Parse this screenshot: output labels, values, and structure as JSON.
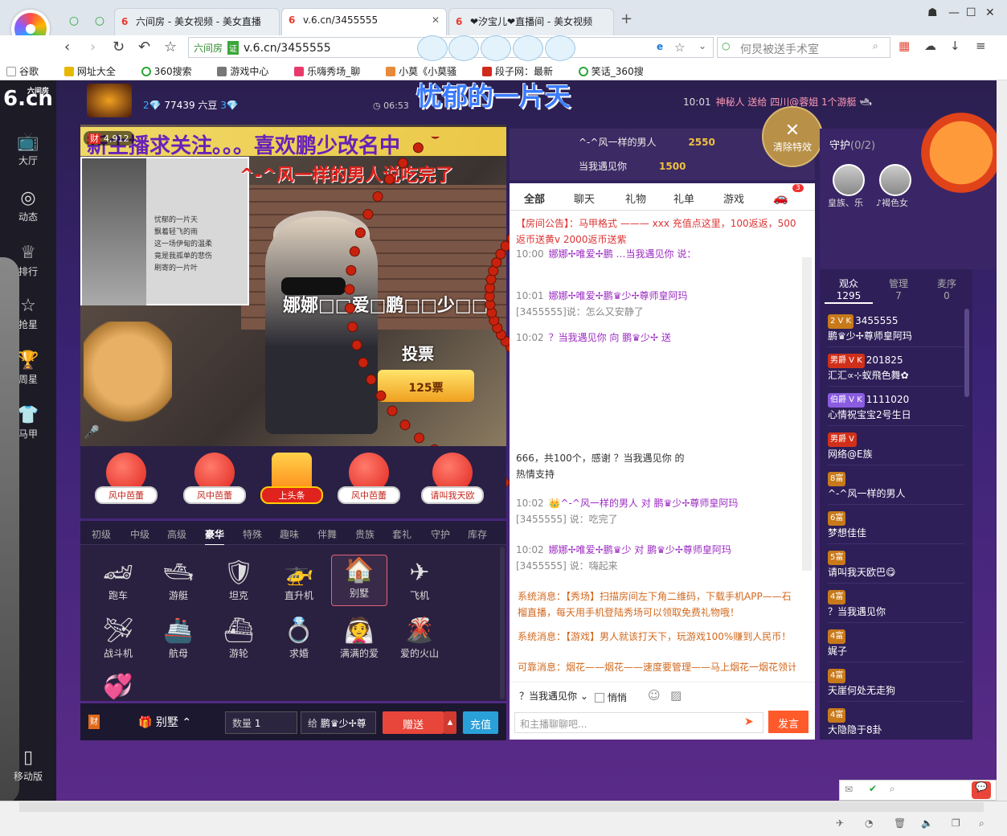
{
  "browser": {
    "tabs": [
      {
        "title": "六间房 - 美女视频 - 美女直播",
        "active": false
      },
      {
        "title": "v.6.cn/3455555",
        "active": true
      },
      {
        "title": "❤汐宝儿❤直播间 - 美女视频",
        "active": false
      }
    ],
    "url_site": "六间房",
    "url_cert": "证",
    "url": "v.6.cn/3455555",
    "search_placeholder": "何炅被送手术室",
    "bookmarks": [
      "谷歌",
      "网址大全",
      "360搜索",
      "游戏中心",
      "乐嗨秀场_聊",
      "小莫《小莫骚",
      "段子网：最新",
      "笑话_360搜"
    ]
  },
  "site": {
    "logo": "6.cn",
    "logo_small": "六间房",
    "nav": [
      {
        "label": "大厅",
        "icon": "tv-icon"
      },
      {
        "label": "动态",
        "icon": "compass-icon"
      },
      {
        "label": "排行",
        "icon": "crown-icon"
      },
      {
        "label": "抢星",
        "icon": "star-icon"
      },
      {
        "label": "周星",
        "icon": "cup-icon"
      },
      {
        "label": "马甲",
        "icon": "shirt-icon"
      }
    ],
    "mobile": "移动版"
  },
  "anchor": {
    "level": "2",
    "beans": "77439 六豆",
    "gem": "3",
    "time": "06:53"
  },
  "topic": "忧郁的一片天",
  "video": {
    "viewers": "4,912",
    "viewer_badge": "财",
    "banner": "新主播求关注。。。喜欢鹏少改名中",
    "overlay_red": "^-^风一样的男人说吃完了",
    "overlay_white": "娜娜□□爱□鹏□□少□□",
    "vote_label": "投票",
    "vote_count": "125票",
    "inset_poem": [
      "忧郁的一片天",
      "飘着轻飞的雨",
      "这一场伊甸的温柔",
      "竟是我孤单的悲伤",
      "刷寄的一片叶"
    ]
  },
  "gift_circles": [
    {
      "label": "风中芭蕾",
      "gold": false
    },
    {
      "label": "风中芭蕾",
      "gold": false
    },
    {
      "label": "上头条",
      "gold": true
    },
    {
      "label": "风中芭蕾",
      "gold": false
    },
    {
      "label": "请叫我天欧",
      "gold": false
    }
  ],
  "gift_tabs": [
    "初级",
    "中级",
    "高级",
    "豪华",
    "特殊",
    "趣味",
    "伴舞",
    "贵族",
    "套礼",
    "守护",
    "库存"
  ],
  "gift_tab_active": "豪华",
  "gifts": [
    {
      "label": "跑车",
      "icon": "🏎"
    },
    {
      "label": "游艇",
      "icon": "🛥"
    },
    {
      "label": "坦克",
      "icon": "🛡"
    },
    {
      "label": "直升机",
      "icon": "🚁"
    },
    {
      "label": "别墅",
      "icon": "🏠",
      "selected": true
    },
    {
      "label": "飞机",
      "icon": "✈"
    },
    {
      "label": "战斗机",
      "icon": "🛩"
    },
    {
      "label": "航母",
      "icon": "🚢"
    },
    {
      "label": "游轮",
      "icon": "⛴"
    },
    {
      "label": "求婚",
      "icon": "💍"
    },
    {
      "label": "满满的爱",
      "icon": "👰"
    },
    {
      "label": "爱的火山",
      "icon": "🌋"
    },
    {
      "label": "",
      "icon": "💞"
    }
  ],
  "sendbar": {
    "selected_gift": "别墅",
    "qty_label": "数量",
    "qty_value": "1",
    "to_label": "给",
    "to_value": "鹏♛少✢尊",
    "give": "赠送",
    "recharge": "充值"
  },
  "rank": [
    {
      "name": "^-^风一样的男人",
      "value": "2550"
    },
    {
      "name": "当我遇见你",
      "value": "1500"
    }
  ],
  "clear_fx": "清除特效",
  "chat_tabs": [
    "全部",
    "聊天",
    "礼物",
    "礼单",
    "游戏"
  ],
  "chat_car_count": "3",
  "top_msgs": [
    {
      "time": "10:01",
      "text": "神秘人 送给 四川@蓉姐 1个游艇"
    }
  ],
  "chat": {
    "notice": "【房间公告】：马甲格式 ——— xxx 充值点这里，100返返，500返币送黄v 2000返币送紫",
    "msgs": [
      {
        "time": "10:00",
        "text": "娜娜✢唯爱✢鹏 …当我遇见你 说："
      },
      {
        "time": "10:01",
        "text": "娜娜✢唯爱✢鹏♛少✢尊师皇阿玛"
      },
      {
        "time": "",
        "text": "[3455555]说：怎么又安静了"
      },
      {
        "time": "10:02",
        "text": "？当我遇见你 向 鹏♛少✢ 送"
      },
      {
        "time": "",
        "text": "666，共100个，感谢 ？当我遇见你 的"
      },
      {
        "time": "",
        "text": "热情支持"
      },
      {
        "time": "10:02",
        "text": "^-^风一样的男人 对 鹏♛少✢尊师皇阿玛"
      },
      {
        "time": "",
        "text": "[3455555] 说：吃完了"
      },
      {
        "time": "10:02",
        "text": "娜娜✢唯爱✢鹏♛少 对 鹏♛少✢尊师皇阿玛"
      },
      {
        "time": "",
        "text": "[3455555] 说：嗨起来"
      }
    ],
    "sys": [
      "系统消息：【秀场】扫描房间左下角二维码，下载手机APP——石榴直播，每天用手机登陆秀场可以领取免费礼物哦！",
      "系统消息：【游戏】男人就该打天下，玩游戏100%赚到人民币！",
      "可靠消息：烟花——烟花——速度要管理——马上烟花一烟花领计"
    ],
    "reply_to": "？当我遇见你",
    "whisper": "悄悄",
    "input_placeholder": "和主播聊聊吧...",
    "send": "发言"
  },
  "guard": {
    "title": "守护",
    "count": "(0/2)",
    "members": [
      "皇族、乐",
      "♪褐色女"
    ]
  },
  "audience": {
    "tabs": [
      {
        "label": "观众",
        "count": "1295"
      },
      {
        "label": "管理",
        "count": "7"
      },
      {
        "label": "麦序",
        "count": "0"
      }
    ],
    "list": [
      {
        "badges": "2 V K",
        "id": "3455555",
        "name": "鹏♛少✢尊师皇阿玛"
      },
      {
        "badges": "男爵 V K",
        "id": "201825",
        "name": "汇汇∝⊹蚁飛色舞✿"
      },
      {
        "badges": "伯爵 V K",
        "id": "1111020",
        "name": "心情祝宝宝2号生日"
      },
      {
        "badges": "男爵 V",
        "id": "",
        "name": "网络@E族"
      },
      {
        "badges": "8富",
        "id": "",
        "name": "^-^风一样的男人"
      },
      {
        "badges": "6富",
        "id": "",
        "name": "梦想佳佳"
      },
      {
        "badges": "5富",
        "id": "",
        "name": "请叫我天欧巴😋"
      },
      {
        "badges": "4富",
        "id": "",
        "name": "？当我遇见你"
      },
      {
        "badges": "4富",
        "id": "",
        "name": "娓子"
      },
      {
        "badges": "4富",
        "id": "",
        "name": "天崖何处无走狗"
      },
      {
        "badges": "4富",
        "id": "",
        "name": "大隐隐于8卦"
      }
    ]
  },
  "colors": {
    "page_bg": "#3a2374",
    "send_red": "#e8463a",
    "recharge_blue": "#2aa0d8",
    "chat_send": "#ff5a2a"
  }
}
